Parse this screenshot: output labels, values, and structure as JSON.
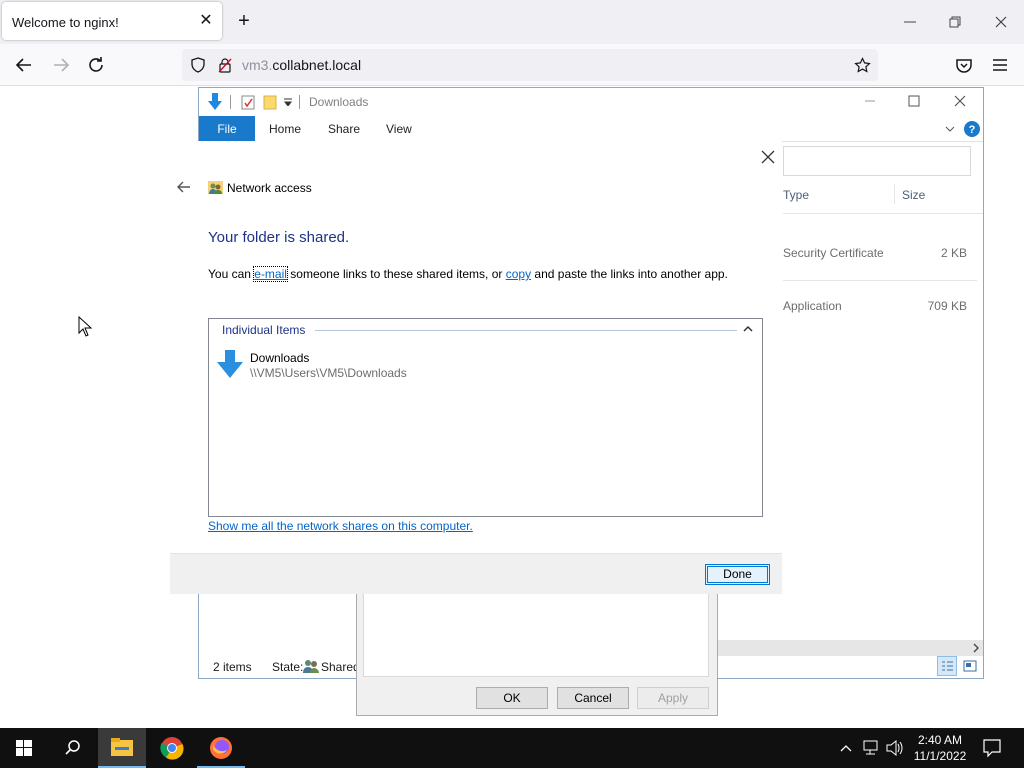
{
  "browser": {
    "tab_title": "Welcome to nginx!",
    "url_host_prefix": "vm3.",
    "url_host_main": "collabnet.local"
  },
  "explorer": {
    "title": "Downloads",
    "ribbon_tabs": [
      "File",
      "Home",
      "Share",
      "View"
    ],
    "columns": {
      "type": "Type",
      "size": "Size"
    },
    "rows": [
      {
        "type": "Security Certificate",
        "size": "2 KB"
      },
      {
        "type": "Application",
        "size": "709 KB"
      }
    ],
    "status_items": "2 items",
    "status_state_label": "State:",
    "status_state_value": "Shared"
  },
  "properties_dialog": {
    "ok": "OK",
    "cancel": "Cancel",
    "apply": "Apply"
  },
  "network_dialog": {
    "title": "Network access",
    "heading": "Your folder is shared.",
    "body_pre": "You can ",
    "body_link1": "e-mail",
    "body_mid": " someone links to these shared items, or ",
    "body_link2": "copy",
    "body_post": " and paste the links into another app.",
    "group_header": "Individual Items",
    "item_name": "Downloads",
    "item_path": "\\\\VM5\\Users\\VM5\\Downloads",
    "shares_link": "Show me all the network shares on this computer.",
    "done": "Done"
  },
  "taskbar": {
    "time": "2:40 AM",
    "date": "11/1/2022"
  },
  "colors": {
    "accent": "#1979ca",
    "link": "#0066cc",
    "heading": "#1e3287",
    "taskbar": "#101010"
  }
}
